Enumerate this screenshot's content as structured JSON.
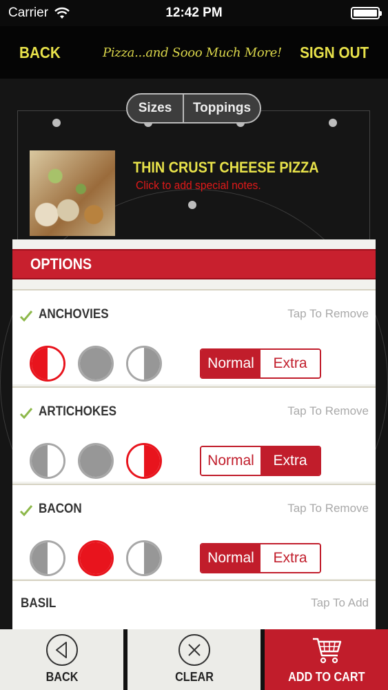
{
  "status_bar": {
    "carrier": "Carrier",
    "time": "12:42 PM"
  },
  "nav": {
    "back": "BACK",
    "tagline": "Pizza...and Sooo Much More!",
    "sign_out": "SIGN OUT"
  },
  "segments": {
    "sizes": "Sizes",
    "toppings": "Toppings"
  },
  "product": {
    "title": "THIN CRUST CHEESE PIZZA",
    "note": "Click to add special notes."
  },
  "options": {
    "title": "OPTIONS",
    "toppings": [
      {
        "name": "ANCHOVIES",
        "action": "Tap To Remove",
        "checked": true,
        "portion": "left",
        "amount": "Normal"
      },
      {
        "name": "ARTICHOKES",
        "action": "Tap To Remove",
        "checked": true,
        "portion": "right",
        "amount": "Extra"
      },
      {
        "name": "BACON",
        "action": "Tap To Remove",
        "checked": true,
        "portion": "whole",
        "amount": "Normal"
      },
      {
        "name": "BASIL",
        "action": "Tap To Add",
        "checked": false
      }
    ],
    "amount_labels": {
      "normal": "Normal",
      "extra": "Extra"
    }
  },
  "bottom_bar": {
    "back": "BACK",
    "clear": "CLEAR",
    "add_to_cart": "ADD TO CART"
  },
  "colors": {
    "accent_red": "#c11d2b",
    "selected_red": "#e8141d",
    "nav_yellow": "#e8e24a"
  },
  "icons": {
    "check": "check-icon",
    "back": "back-arrow-icon",
    "clear": "clear-x-icon",
    "cart": "cart-icon"
  }
}
